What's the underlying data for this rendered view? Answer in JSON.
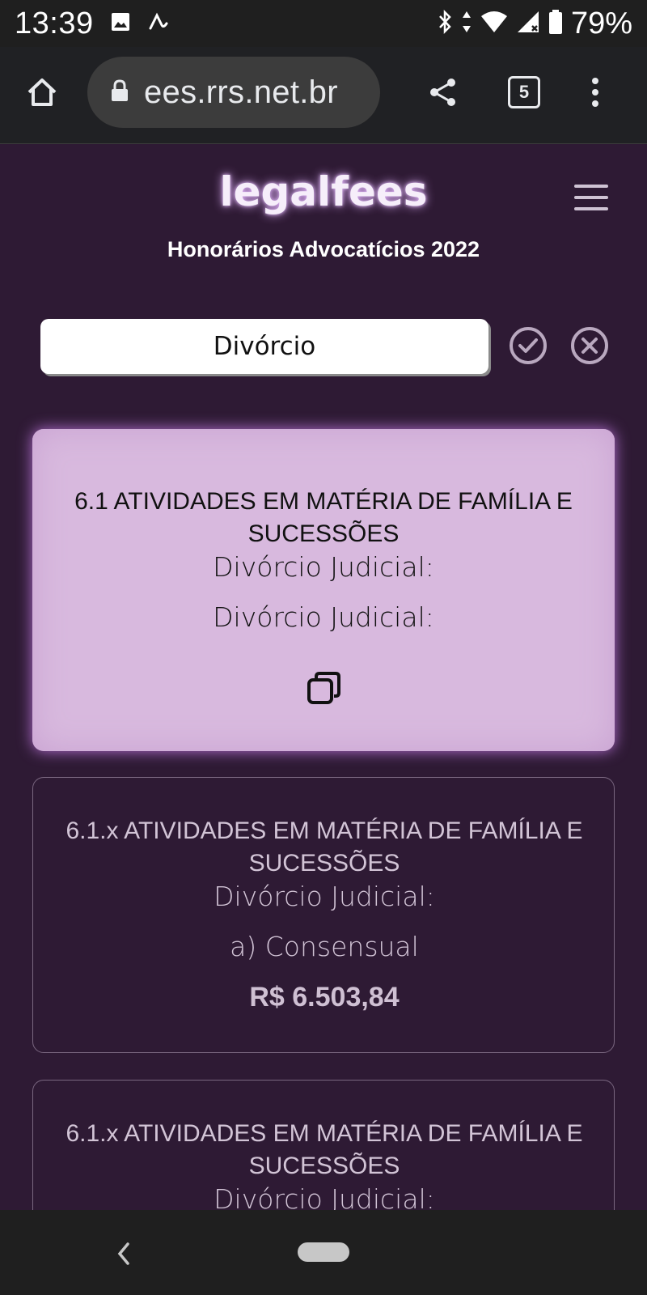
{
  "status_bar": {
    "time": "13:39",
    "battery": "79%",
    "icons": [
      "image-icon",
      "app-icon",
      "bluetooth-icon",
      "data-icon",
      "wifi-icon",
      "signal-icon",
      "battery-icon"
    ]
  },
  "browser": {
    "url": "ees.rrs.net.br",
    "tab_count": "5"
  },
  "header": {
    "brand": "legalfees",
    "subtitle": "Honorários Advocatícios 2022"
  },
  "search": {
    "value": "Divórcio"
  },
  "cards": [
    {
      "title": "6.1 ATIVIDADES EM MATÉRIA DE FAMÍLIA E SUCESSÕES",
      "subtitle": "Divórcio Judicial:",
      "detail": "Divórcio Judicial:"
    },
    {
      "title": "6.1.x ATIVIDADES EM MATÉRIA DE FAMÍLIA E SUCESSÕES",
      "subtitle": "Divórcio Judicial:",
      "detail": "a) Consensual",
      "price": "R$ 6.503,84"
    },
    {
      "title": "6.1.x ATIVIDADES EM MATÉRIA DE FAMÍLIA E SUCESSÕES",
      "subtitle": "Divórcio Judicial:"
    }
  ],
  "colors": {
    "background": "#2e1a34",
    "active_card": "#d8b9de",
    "glow": "#d7a8f0"
  }
}
